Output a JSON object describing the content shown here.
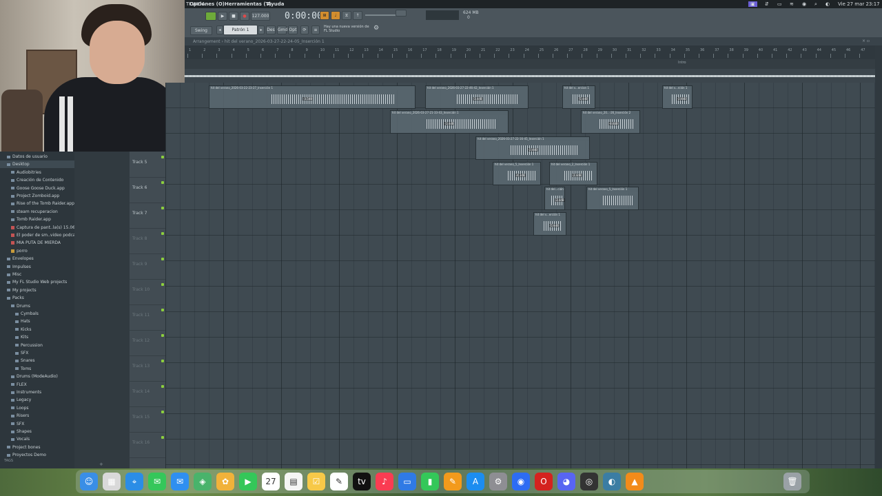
{
  "menubar": {
    "app": "Opciones (O)",
    "tools": "Herramientas (T)",
    "help": "Ayuda",
    "clock": "Vie 27 mar 23:17",
    "left_tag": "TI WIDA"
  },
  "toolbar": {
    "tempo": "127.000",
    "time": "0:00:00",
    "pattern": "Patrón 1",
    "pattern_buttons": [
      "Des",
      "Gmd",
      "Opt"
    ],
    "mode": "Swing",
    "news": "Hay una nueva versión de FL Studio ",
    "memory": "624 MB",
    "memory_sub": "0"
  },
  "playlist": {
    "title": "Arrangement › hit del verano_2026-03-27-22-24-05_Inserción 1",
    "ruler": [
      "1",
      "2",
      "3",
      "4",
      "5",
      "6",
      "7",
      "8",
      "9",
      "10",
      "11",
      "12",
      "13",
      "14",
      "15",
      "16",
      "17",
      "18",
      "19",
      "20",
      "21",
      "22",
      "23",
      "24",
      "25",
      "26",
      "27",
      "28",
      "29",
      "30",
      "31",
      "32",
      "33",
      "34",
      "35",
      "36",
      "37",
      "38",
      "39",
      "40",
      "41",
      "42",
      "43",
      "44",
      "45",
      "46",
      "47"
    ],
    "marker": "Intro",
    "tracks": [
      "Track 5",
      "Track 6",
      "Track 7",
      "Track 8",
      "Track 9",
      "Track 10",
      "Track 11",
      "Track 12",
      "Track 13",
      "Track 14",
      "Track 15",
      "Track 16"
    ],
    "clips": [
      {
        "label": "hit del verano_2026-03-22-23-27_Inserción 1",
        "vol": "-3.5dB"
      },
      {
        "label": "hit del verano_2026-03-27-22-46-42_Inserción 1",
        "vol": "-3.4dB"
      },
      {
        "label": "hit del v...ercion 1",
        "vol": "-5.4dB"
      },
      {
        "label": "hit del v...rción 1",
        "vol": "-2.4dB"
      },
      {
        "label": "hit del verano_2026-03-27-21-33-43_Inserción 1",
        "vol": "-1.4dB"
      },
      {
        "label": "hit del verano_20...-26_Inserción 2",
        "vol": "-8.4dB"
      },
      {
        "label": "hit del verano_2026-03-27-22-16-45_Inserción 1",
        "vol": "-2.4dB"
      },
      {
        "label": "hit del verano_5_Inserción 1",
        "vol": "-4.3dB"
      },
      {
        "label": "hit del verano_2_Inserción 1",
        "vol": "-2.4dB"
      },
      {
        "label": "hit del...ción 1",
        "vol": "-2.4dB"
      },
      {
        "label": "hit del verano_5_Inserción 1",
        "vol": ""
      },
      {
        "label": "hit del v...erción 1",
        "vol": "-5.6dB"
      }
    ]
  },
  "browser": {
    "items": [
      {
        "label": "Datos de usuario",
        "kind": "folder"
      },
      {
        "label": "Desktop",
        "kind": "folder"
      },
      {
        "label": "Audiobitries",
        "kind": "folder"
      },
      {
        "label": "Creación de Contenido",
        "kind": "folder"
      },
      {
        "label": "Goose Goose Duck.app",
        "kind": "folder"
      },
      {
        "label": "Project Zomboid.app",
        "kind": "folder"
      },
      {
        "label": "Rise of the Tomb Raider.app",
        "kind": "folder"
      },
      {
        "label": "steam recuperacion",
        "kind": "folder"
      },
      {
        "label": "Tomb Raider.app",
        "kind": "folder"
      },
      {
        "label": "Captura de pant..la(s) 15.06.21",
        "kind": "doc"
      },
      {
        "label": "El poder de sm..video podcast",
        "kind": "doc"
      },
      {
        "label": "MIA PUTA DE MIERDA",
        "kind": "doc"
      },
      {
        "label": "porro",
        "kind": "tag"
      },
      {
        "label": "Envelopes",
        "kind": "folder"
      },
      {
        "label": "Impulses",
        "kind": "folder"
      },
      {
        "label": "Misc",
        "kind": "folder"
      },
      {
        "label": "My FL Studio Web projects",
        "kind": "folder"
      },
      {
        "label": "My projects",
        "kind": "folder"
      },
      {
        "label": "Packs",
        "kind": "folder"
      },
      {
        "label": "Drums",
        "kind": "folder"
      },
      {
        "label": "Cymbals",
        "kind": "folder"
      },
      {
        "label": "Hats",
        "kind": "folder"
      },
      {
        "label": "Kicks",
        "kind": "folder"
      },
      {
        "label": "Kits",
        "kind": "folder"
      },
      {
        "label": "Percussion",
        "kind": "folder"
      },
      {
        "label": "SFX",
        "kind": "folder"
      },
      {
        "label": "Snares",
        "kind": "folder"
      },
      {
        "label": "Toms",
        "kind": "folder"
      },
      {
        "label": "Drums (ModeAudio)",
        "kind": "folder"
      },
      {
        "label": "FLEX",
        "kind": "folder"
      },
      {
        "label": "Instruments",
        "kind": "folder"
      },
      {
        "label": "Legacy",
        "kind": "folder"
      },
      {
        "label": "Loops",
        "kind": "folder"
      },
      {
        "label": "Risers",
        "kind": "folder"
      },
      {
        "label": "SFX",
        "kind": "folder"
      },
      {
        "label": "Shapes",
        "kind": "folder"
      },
      {
        "label": "Vocals",
        "kind": "folder"
      },
      {
        "label": "Project bones",
        "kind": "folder"
      },
      {
        "label": "Proyectos Demo",
        "kind": "folder"
      }
    ],
    "footer": "TAGS"
  },
  "dock": {
    "apps": [
      "finder-icon",
      "launchpad-icon",
      "safari-icon",
      "messages-icon",
      "mail-icon",
      "maps-icon",
      "photos-icon",
      "facetime-icon",
      "calendar-icon",
      "notes-icon",
      "reminders-icon",
      "freeform-icon",
      "tv-icon",
      "music-icon",
      "keynote-icon",
      "numbers-icon",
      "pages-icon",
      "appstore-icon",
      "settings-icon",
      "zoom-icon",
      "opera-icon",
      "discord-icon",
      "obs-icon",
      "davinci-icon",
      "fl-studio-icon"
    ],
    "calendar_day": "27"
  }
}
